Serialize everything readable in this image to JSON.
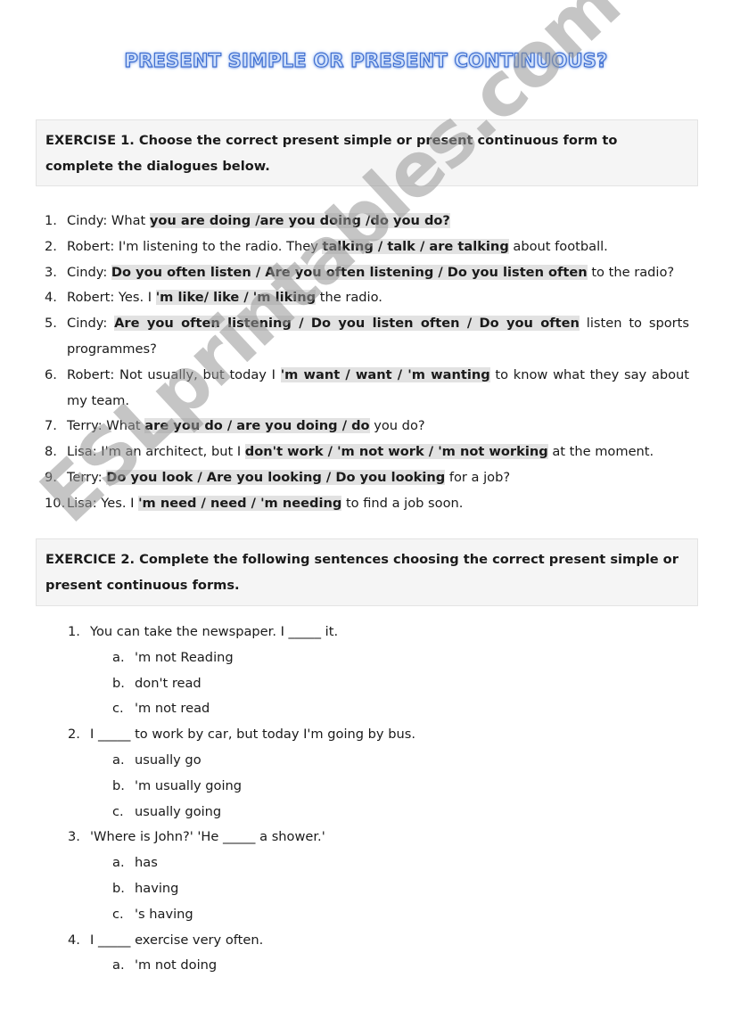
{
  "title": "PRESENT SIMPLE OR PRESENT CONTINUOUS?",
  "watermark": "ESLprintables.com",
  "colors": {
    "title_fill": "#cfe0fb",
    "title_outline": "#3f6fd1",
    "highlight": "#e2e2e2",
    "box_bg": "#f5f5f5"
  },
  "exercise1": {
    "instruction": "EXERCISE 1. Choose the correct present simple or present continuous form to complete the dialogues below.",
    "items": [
      {
        "num": "1.",
        "before": "Cindy: What ",
        "choice": "you are doing /are you doing /do you do?",
        "after": ""
      },
      {
        "num": "2.",
        "before": "Robert: I'm listening to the radio. They ",
        "choice": "talking / talk / are talking",
        "after": " about football."
      },
      {
        "num": "3.",
        "before": "Cindy: ",
        "choice": "Do you often listen / Are you often listening / Do you listen often",
        "after": " to the radio?"
      },
      {
        "num": "4.",
        "before": "Robert: Yes. I ",
        "choice": "'m like/ like / 'm liking",
        "after": " the radio."
      },
      {
        "num": "5.",
        "before": "Cindy: ",
        "choice": "Are you often listening / Do you listen often / Do you often",
        "after": " listen to sports programmes?"
      },
      {
        "num": "6.",
        "before": "Robert: Not usually, but today I ",
        "choice": "'m want / want / 'm wanting",
        "after": " to know what they say about my team."
      },
      {
        "num": "7.",
        "before": "Terry: What ",
        "choice": "are you do / are you doing / do",
        "after": " you do?"
      },
      {
        "num": "8.",
        "before": "Lisa: I'm an architect, but I ",
        "choice": "don't work / 'm not work / 'm not working",
        "after": " at the moment."
      },
      {
        "num": "9.",
        "before": "Terry: ",
        "choice": "Do you look / Are you looking / Do you looking",
        "after": " for a job?"
      },
      {
        "num": "10.",
        "before": "Lisa: Yes. I ",
        "choice": "'m need / need / 'm needing",
        "after": " to find a job soon."
      }
    ]
  },
  "exercise2": {
    "instruction": "EXERCICE 2. Complete the following sentences choosing the correct present simple or present continuous forms.",
    "questions": [
      {
        "num": "1.",
        "text": "You can take the newspaper. I _____ it.",
        "options": [
          {
            "letter": "a.",
            "text": "'m not Reading"
          },
          {
            "letter": "b.",
            "text": "don't read"
          },
          {
            "letter": "c.",
            "text": "'m not read"
          }
        ]
      },
      {
        "num": "2.",
        "text": "I _____ to work by car, but today I'm going by bus.",
        "options": [
          {
            "letter": "a.",
            "text": "usually go"
          },
          {
            "letter": "b.",
            "text": "'m usually going"
          },
          {
            "letter": "c.",
            "text": "usually going"
          }
        ]
      },
      {
        "num": "3.",
        "text": "'Where is John?' 'He _____ a shower.'",
        "options": [
          {
            "letter": "a.",
            "text": "has"
          },
          {
            "letter": "b.",
            "text": "having"
          },
          {
            "letter": "c.",
            "text": "'s having"
          }
        ]
      },
      {
        "num": "4.",
        "text": "I _____ exercise very often.",
        "options": [
          {
            "letter": "a.",
            "text": "'m not doing"
          }
        ]
      }
    ]
  }
}
